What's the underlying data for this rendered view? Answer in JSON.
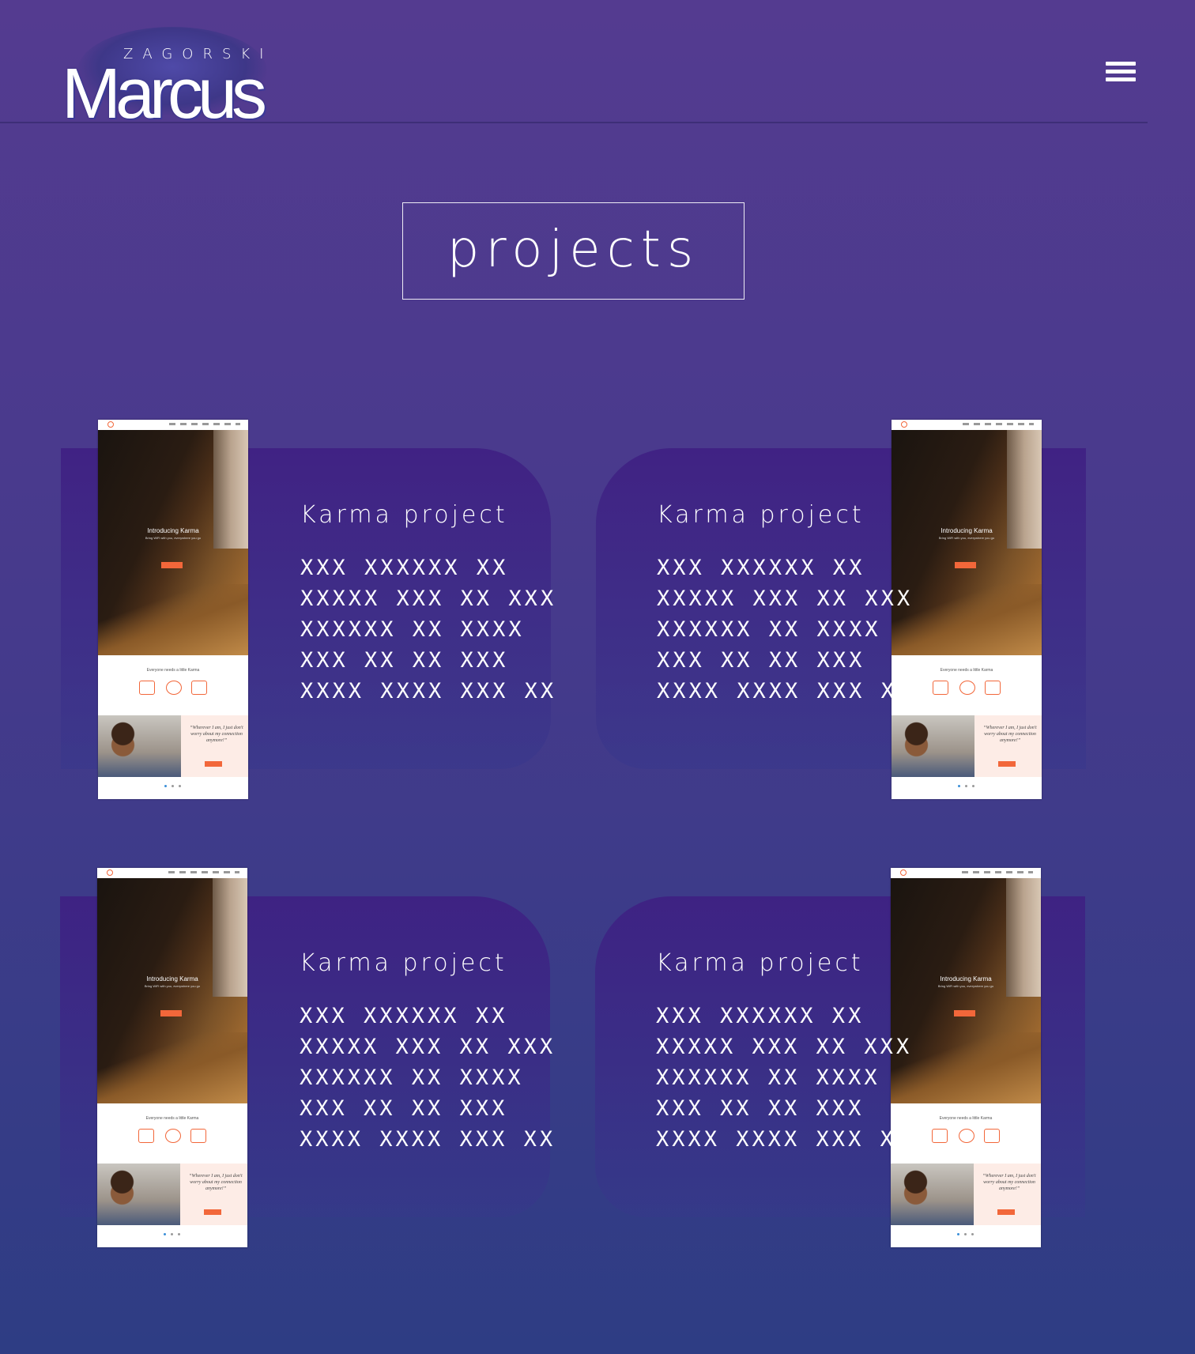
{
  "header": {
    "logo_top": "ZAGORSKI",
    "logo_main": "Marcus",
    "menu_icon": "hamburger-menu-icon"
  },
  "page": {
    "title": "projects"
  },
  "projects": [
    {
      "title": "Karma project",
      "lines": [
        "XXX XXXXXX XX",
        "XXXXX XXX XX XXX",
        "XXXXXX XX XXXX",
        "XXX XX XX XXX",
        "XXXX XXXX XXX XX"
      ],
      "screenshot": {
        "hero_title": "Introducing Karma",
        "hero_sub": "Bring WiFi with you, everywhere you go",
        "mid_title": "Everyone needs a little Karma",
        "quote": "“Wherever I am, I just don't worry about my connection anymore!”"
      }
    },
    {
      "title": "Karma project",
      "lines": [
        "XXX XXXXXX XX",
        "XXXXX XXX XX XXX",
        "XXXXXX XX XXXX",
        "XXX XX XX XXX",
        "XXXX XXXX XXX XX"
      ],
      "screenshot": {
        "hero_title": "Introducing Karma",
        "hero_sub": "Bring WiFi with you, everywhere you go",
        "mid_title": "Everyone needs a little Karma",
        "quote": "“Wherever I am, I just don't worry about my connection anymore!”"
      }
    },
    {
      "title": "Karma project",
      "lines": [
        "XXX XXXXXX XX",
        "XXXXX XXX XX XXX",
        "XXXXXX XX XXXX",
        "XXX XX XX XXX",
        "XXXX XXXX XXX XX"
      ],
      "screenshot": {
        "hero_title": "Introducing Karma",
        "hero_sub": "Bring WiFi with you, everywhere you go",
        "mid_title": "Everyone needs a little Karma",
        "quote": "“Wherever I am, I just don't worry about my connection anymore!”"
      }
    },
    {
      "title": "Karma project",
      "lines": [
        "XXX XXXXXX XX",
        "XXXXX XXX XX XXX",
        "XXXXXX XX XXXX",
        "XXX XX XX XXX",
        "XXXX XXXX XXX XX"
      ],
      "screenshot": {
        "hero_title": "Introducing Karma",
        "hero_sub": "Bring WiFi with you, everywhere you go",
        "mid_title": "Everyone needs a little Karma",
        "quote": "“Wherever I am, I just don't worry about my connection anymore!”"
      }
    }
  ]
}
